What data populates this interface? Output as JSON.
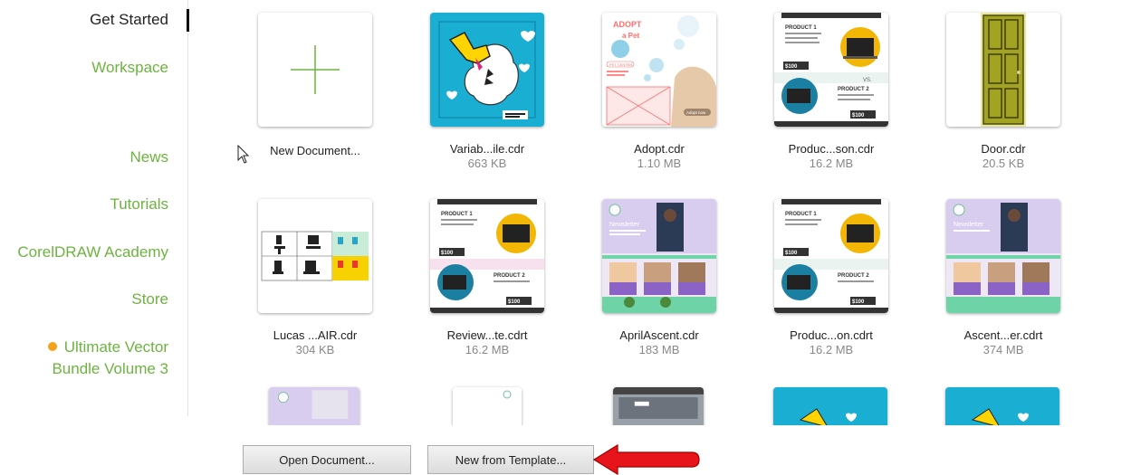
{
  "sidebar": {
    "items": [
      {
        "label": "Get Started",
        "active": true
      },
      {
        "label": "Workspace"
      },
      {
        "label": "News"
      },
      {
        "label": "Tutorials"
      },
      {
        "label": "CorelDRAW Academy"
      },
      {
        "label": "Store"
      }
    ],
    "promo": {
      "line1": "Ultimate Vector",
      "line2": "Bundle Volume 3",
      "dot_color": "#f5a21b"
    },
    "accent_color": "#6db33f"
  },
  "files": [
    {
      "name": "New Document...",
      "size": "",
      "icon": "plus-icon"
    },
    {
      "name": "Variab...ile.cdr",
      "size": "663 KB"
    },
    {
      "name": "Adopt.cdr",
      "size": "1.10 MB"
    },
    {
      "name": "Produc...son.cdr",
      "size": "16.2 MB"
    },
    {
      "name": "Door.cdr",
      "size": "20.5 KB"
    },
    {
      "name": "Lucas ...AIR.cdr",
      "size": "304 KB"
    },
    {
      "name": "Review...te.cdrt",
      "size": "16.2 MB"
    },
    {
      "name": "AprilAscent.cdr",
      "size": "183 MB"
    },
    {
      "name": "Produc...on.cdrt",
      "size": "16.2 MB"
    },
    {
      "name": "Ascent...er.cdrt",
      "size": "374 MB"
    }
  ],
  "thumb_text": {
    "adopt_title": "ADOPT",
    "adopt_sub": "a Pet",
    "pet_center": "PET CENTER",
    "adopt_now": "Adopt now",
    "product1": "PRODUCT 1",
    "product2": "PRODUCT 2",
    "price": "$100",
    "vs": "VS.",
    "newsletter": "Newsletter"
  },
  "buttons": {
    "open_document": "Open Document...",
    "new_from_template": "New from Template..."
  }
}
